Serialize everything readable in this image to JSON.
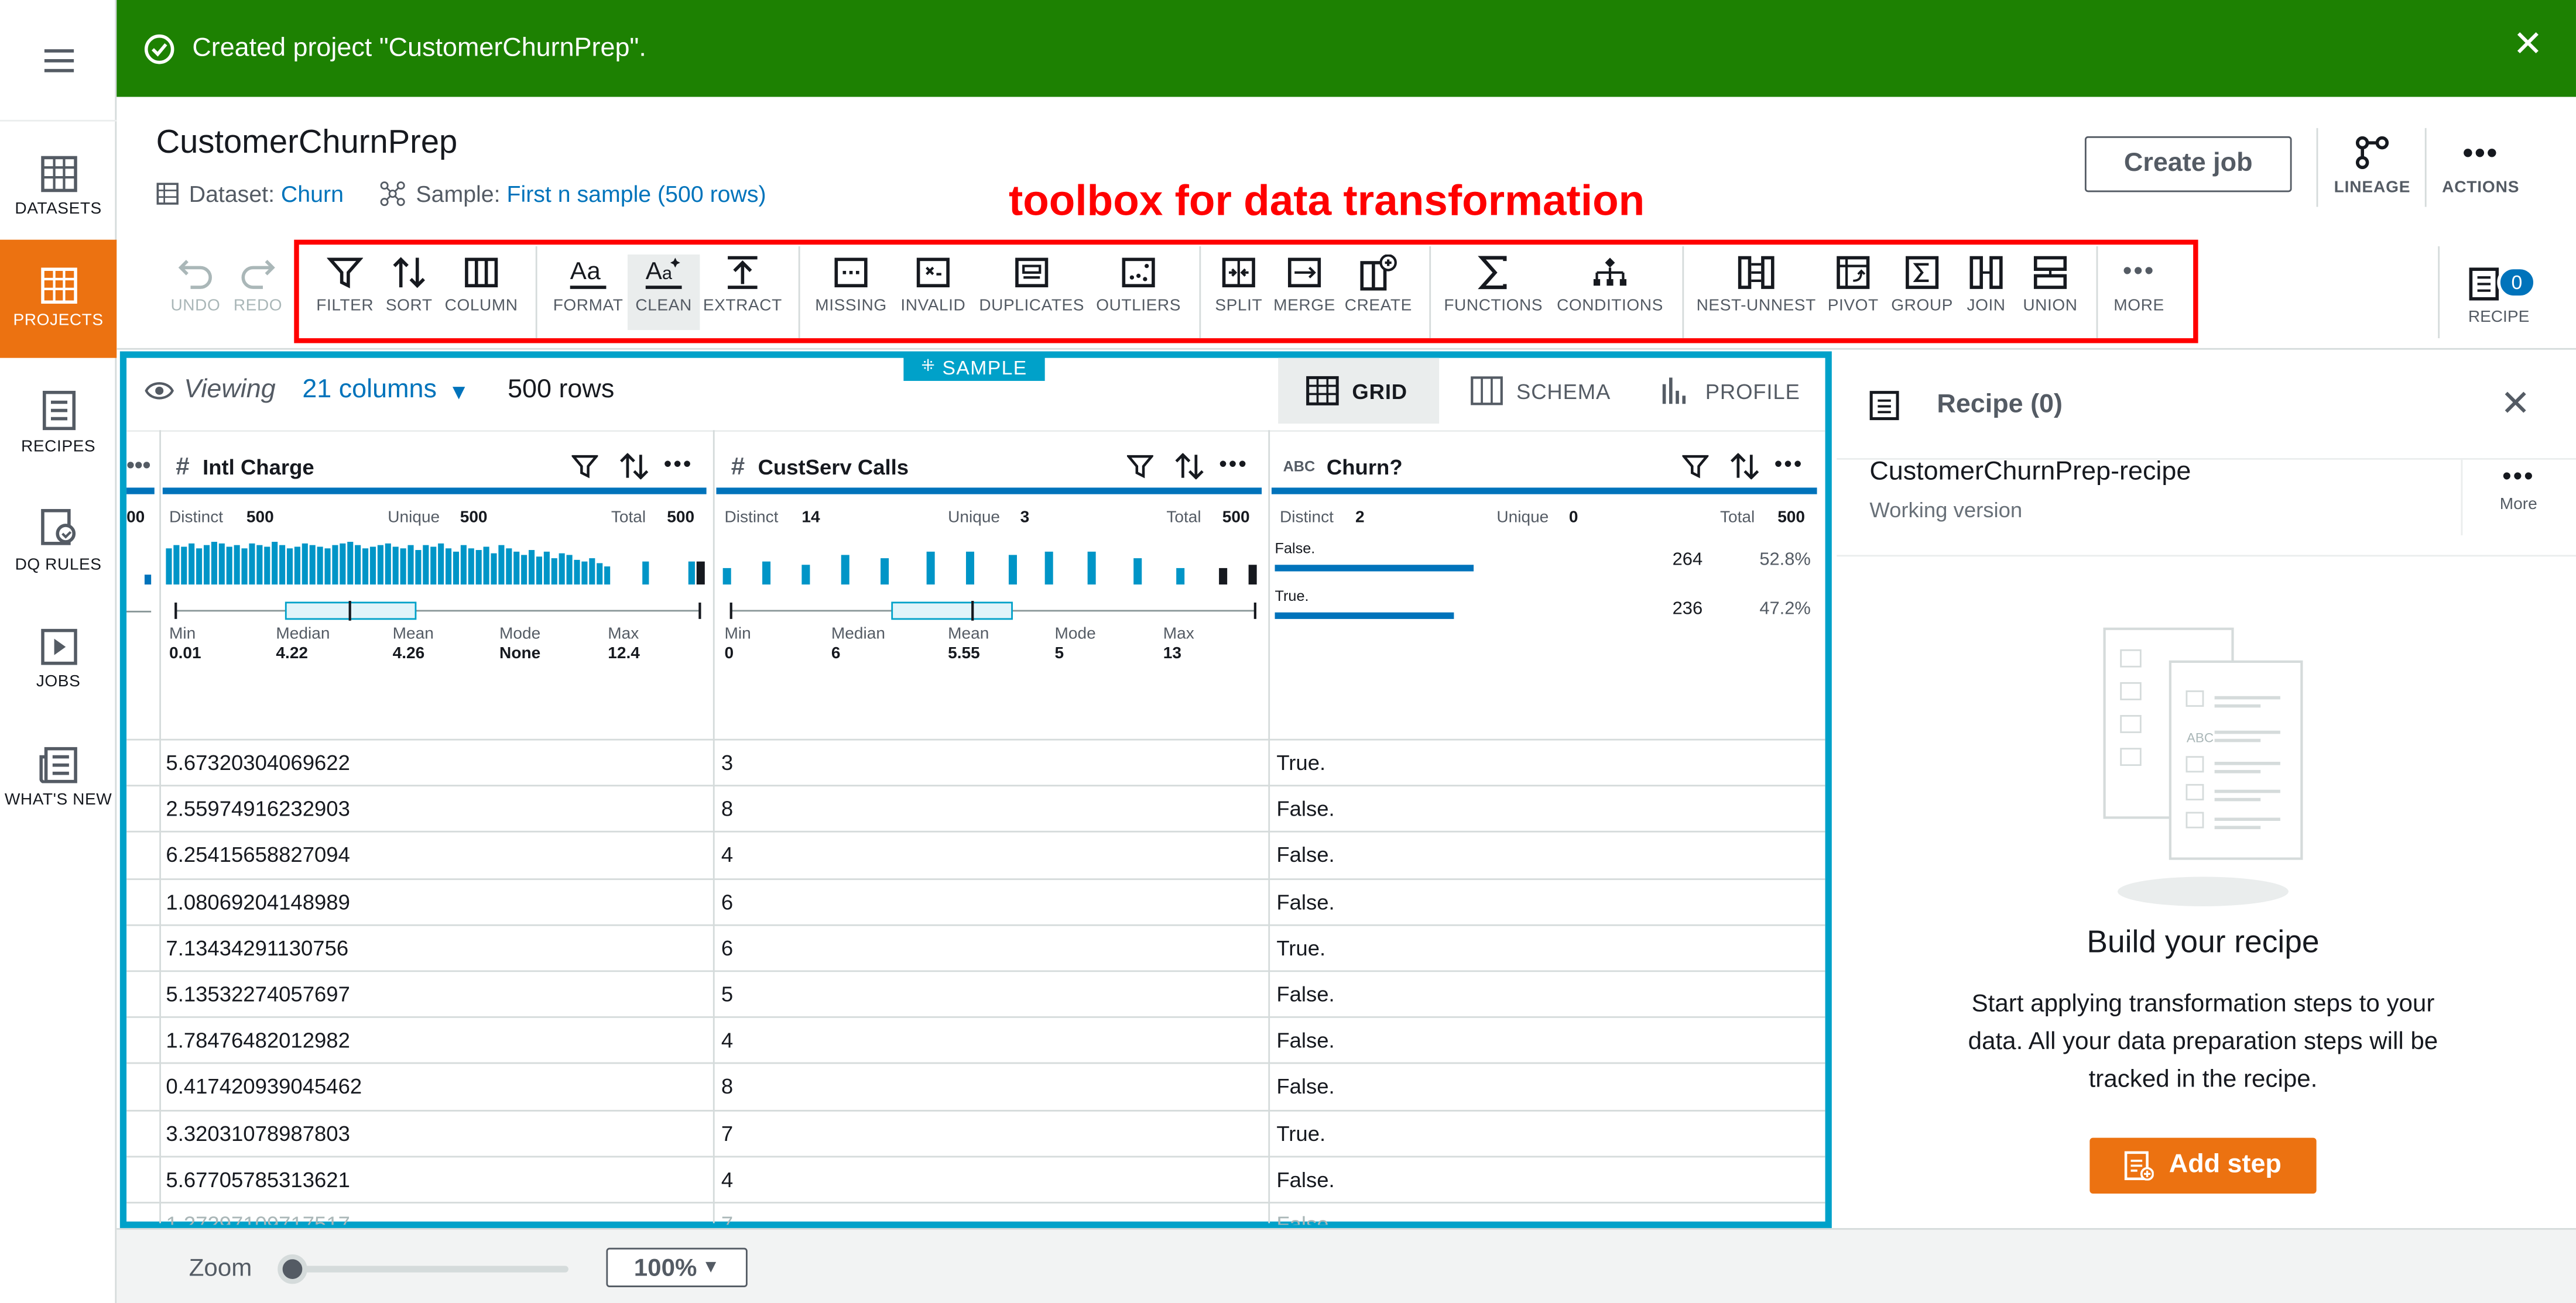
{
  "banner": {
    "message": "Created project \"CustomerChurnPrep\"."
  },
  "nav": {
    "items": [
      {
        "label": "DATASETS",
        "icon": "table-icon"
      },
      {
        "label": "PROJECTS",
        "icon": "projects-icon",
        "active": true
      },
      {
        "label": "RECIPES",
        "icon": "recipe-icon"
      },
      {
        "label": "DQ RULES",
        "icon": "dq-rules-icon"
      },
      {
        "label": "JOBS",
        "icon": "jobs-icon"
      },
      {
        "label": "WHAT'S NEW",
        "icon": "news-icon"
      }
    ]
  },
  "header": {
    "title": "CustomerChurnPrep",
    "dataset_label": "Dataset:",
    "dataset_value": "Churn",
    "sample_label": "Sample:",
    "sample_value": "First n sample (500 rows)",
    "create_job": "Create job",
    "lineage": "LINEAGE",
    "actions": "ACTIONS"
  },
  "annotation": "toolbox for data transformation",
  "toolbar": {
    "undo": "UNDO",
    "redo": "REDO",
    "filter": "FILTER",
    "sort": "SORT",
    "column": "COLUMN",
    "format": "FORMAT",
    "clean": "CLEAN",
    "extract": "EXTRACT",
    "missing": "MISSING",
    "invalid": "INVALID",
    "duplicates": "DUPLICATES",
    "outliers": "OUTLIERS",
    "split": "SPLIT",
    "merge": "MERGE",
    "create": "CREATE",
    "functions": "FUNCTIONS",
    "conditions": "CONDITIONS",
    "nest_unnest": "NEST-UNNEST",
    "pivot": "PIVOT",
    "group": "GROUP",
    "join": "JOIN",
    "union": "UNION",
    "more": "MORE",
    "recipe": "RECIPE",
    "recipe_count": "0"
  },
  "grid": {
    "sample_tag": "SAMPLE",
    "viewing": "Viewing",
    "columns": "21 columns",
    "rows": "500 rows",
    "tabs": {
      "grid": "GRID",
      "schema": "SCHEMA",
      "profile": "PROFILE"
    },
    "partial_label": "00",
    "col_type_num": "#",
    "col_type_abc": "ABC",
    "columns_data": [
      {
        "name": "Intl Charge",
        "distinct_label": "Distinct",
        "distinct": "500",
        "unique_label": "Unique",
        "unique": "500",
        "total_label": "Total",
        "total": "500",
        "min_label": "Min",
        "min": "0.01",
        "median_label": "Median",
        "median": "4.22",
        "mean_label": "Mean",
        "mean": "4.26",
        "mode_label": "Mode",
        "mode": "None",
        "max_label": "Max",
        "max": "12.4"
      },
      {
        "name": "CustServ Calls",
        "distinct_label": "Distinct",
        "distinct": "14",
        "unique_label": "Unique",
        "unique": "3",
        "total_label": "Total",
        "total": "500",
        "min_label": "Min",
        "min": "0",
        "median_label": "Median",
        "median": "6",
        "mean_label": "Mean",
        "mean": "5.55",
        "mode_label": "Mode",
        "mode": "5",
        "max_label": "Max",
        "max": "13"
      },
      {
        "name": "Churn?",
        "distinct_label": "Distinct",
        "distinct": "2",
        "unique_label": "Unique",
        "unique": "0",
        "total_label": "Total",
        "total": "500",
        "values": [
          {
            "label": "False.",
            "count": "264",
            "pct": "52.8%",
            "share": 0.528
          },
          {
            "label": "True.",
            "count": "236",
            "pct": "47.2%",
            "share": 0.472
          }
        ]
      }
    ],
    "rows_data": [
      [
        "5.67320304069622",
        "3",
        "True."
      ],
      [
        "2.55974916232903",
        "8",
        "False."
      ],
      [
        "6.25415658827094",
        "4",
        "False."
      ],
      [
        "1.08069204148989",
        "6",
        "False."
      ],
      [
        "7.13434291130756",
        "6",
        "True."
      ],
      [
        "5.13532274057697",
        "5",
        "False."
      ],
      [
        "1.78476482012982",
        "4",
        "False."
      ],
      [
        "0.417420939045462",
        "8",
        "False."
      ],
      [
        "3.32031078987803",
        "7",
        "True."
      ],
      [
        "5.67705785313621",
        "4",
        "False."
      ]
    ]
  },
  "recipe_panel": {
    "title": "Recipe (0)",
    "name": "CustomerChurnPrep-recipe",
    "version": "Working version",
    "more": "More",
    "empty_title": "Build your recipe",
    "empty_line1": "Start applying transformation steps to your",
    "empty_line2": "data. All your data preparation steps will be",
    "empty_line3": "tracked in the recipe.",
    "add_step": "Add step"
  },
  "zoom": {
    "label": "Zoom",
    "value": "100%",
    "level": 0
  }
}
